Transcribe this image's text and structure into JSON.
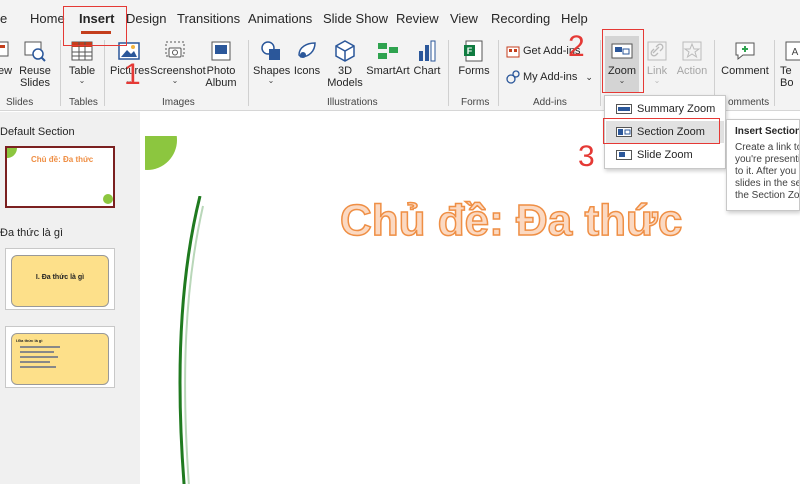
{
  "tabs": [
    {
      "label": "e"
    },
    {
      "label": "Home"
    },
    {
      "label": "Insert"
    },
    {
      "label": "Design"
    },
    {
      "label": "Transitions"
    },
    {
      "label": "Animations"
    },
    {
      "label": "Slide Show"
    },
    {
      "label": "Review"
    },
    {
      "label": "View"
    },
    {
      "label": "Recording"
    },
    {
      "label": "Help"
    }
  ],
  "ribbon": {
    "slides": {
      "new_label": "ew",
      "reuse_label": "Reuse",
      "reuse_label2": "Slides",
      "group": "Slides"
    },
    "tables": {
      "table_label": "Table",
      "group": "Tables"
    },
    "images": {
      "pictures": "Pictures",
      "screenshot": "Screenshot",
      "photo": "Photo",
      "album": "Album",
      "group": "Images"
    },
    "illustrations": {
      "shapes": "Shapes",
      "icons": "Icons",
      "models_3d": "3D",
      "models_3d_2": "Models",
      "smartart": "SmartArt",
      "chart": "Chart",
      "group": "Illustrations"
    },
    "forms": {
      "forms": "Forms",
      "group": "Forms"
    },
    "addins": {
      "get": "Get Add-ins",
      "my": "My Add-ins",
      "group": "Add-ins"
    },
    "links": {
      "zoom": "Zoom",
      "link": "Link",
      "action": "Action"
    },
    "comments": {
      "comment": "Comment",
      "group": "omments",
      "text_label": "Te",
      "text_label2": "Bo"
    }
  },
  "zoom_menu": [
    {
      "label": "Summary Zoom"
    },
    {
      "label": "Section Zoom"
    },
    {
      "label": "Slide Zoom"
    }
  ],
  "tooltip": {
    "title": "Insert Section",
    "lines": [
      "Create a link to",
      "you're presenti",
      "to it. After you",
      "slides in the sec",
      "the Section Zoo"
    ]
  },
  "left_panel": {
    "section1": "Default Section",
    "thumb1_title": "Chủ đề: Đa thức",
    "section2": "Đa thức là gì",
    "thumb2_title": "I. Đa thức là gì",
    "thumb3_heading": "I.Đa thức là gì"
  },
  "slide": {
    "title": "Chủ đề: Đa thức"
  },
  "annotations": [
    "1",
    "2",
    "3"
  ],
  "colors": {
    "accent": "#c43e1c",
    "annotation": "#e53935",
    "title_fill": "#fbd9c2",
    "title_stroke": "#ef8f45"
  }
}
